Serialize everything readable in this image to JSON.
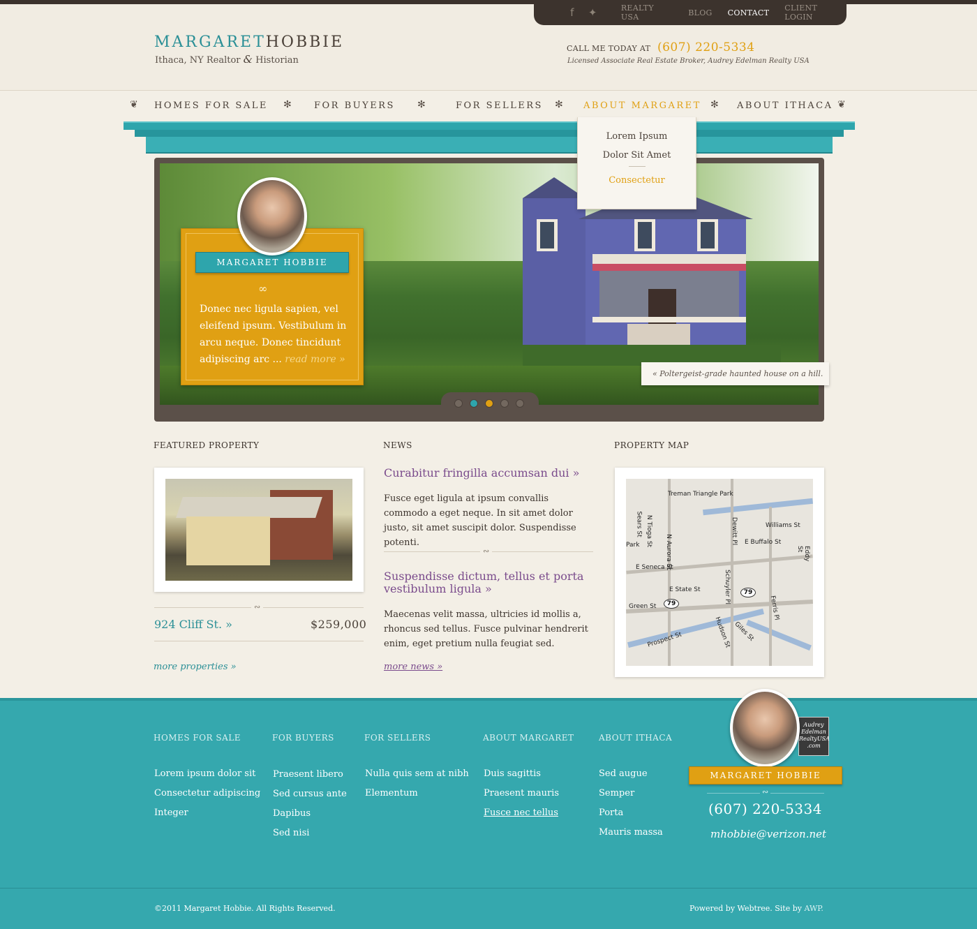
{
  "utility_nav": {
    "icons": [
      "facebook-icon",
      "twitter-icon"
    ],
    "links": [
      "REALTY USA",
      "BLOG",
      "CONTACT",
      "CLIENT LOGIN"
    ]
  },
  "logo": {
    "first": "MARGARET",
    "last": "HOBBIE",
    "tagline_a": "Ithaca, NY Realtor ",
    "tagline_amp": "&",
    "tagline_b": " Historian"
  },
  "contact": {
    "call_label": "CALL ME TODAY AT",
    "phone": "(607) 220-5334",
    "licensed": "Licensed Associate Real Estate Broker, Audrey Edelman Realty USA"
  },
  "main_nav": [
    "HOMES FOR SALE",
    "FOR BUYERS",
    "FOR SELLERS",
    "ABOUT MARGARET",
    "ABOUT ITHACA"
  ],
  "dropdown": [
    "Lorem Ipsum",
    "Dolor Sit Amet",
    "Consectetur"
  ],
  "hero": {
    "name": "MARGARET HOBBIE",
    "text": "Donec nec ligula sapien, vel eleifend ipsum. Vestibulum in arcu neque. Donec tincidunt adipiscing arc ...",
    "more": "read more »",
    "caption": "« Poltergeist-grade haunted house on a hill.",
    "slides": 5,
    "active_slide": 3
  },
  "featured": {
    "title": "FEATURED PROPERTY",
    "address": "924 Cliff St. »",
    "price": "$259,000",
    "more": "more properties »"
  },
  "news": {
    "title": "NEWS",
    "items": [
      {
        "headline": "Curabitur fringilla accumsan dui »",
        "body": "Fusce eget ligula at ipsum convallis commodo a eget neque. In sit amet dolor justo, sit amet suscipit dolor. Suspendisse potenti."
      },
      {
        "headline": "Suspendisse dictum, tellus et porta vestibulum ligula »",
        "body": "Maecenas velit massa, ultricies id mollis a, rhoncus sed tellus. Fusce pulvinar hendrerit enim, eget pretium nulla feugiat sed."
      }
    ],
    "more": "more news »"
  },
  "map": {
    "title": "PROPERTY MAP",
    "labels": [
      "Treman Triangle Park",
      "Sears St",
      "N Tioga St",
      "N Aurora St",
      "Williams St",
      "Dewitt Pl",
      "E Buffalo St",
      "Park",
      "E Seneca St",
      "Schuyler Pl",
      "E State St",
      "Green St",
      "Prospect St",
      "Hudson St",
      "Giles St",
      "Ferris Pl",
      "Eddy St",
      "79"
    ]
  },
  "footer": {
    "columns": [
      {
        "title": "HOMES FOR SALE",
        "links": [
          "Lorem ipsum dolor sit",
          "Consectetur adipiscing",
          "Integer"
        ]
      },
      {
        "title": "FOR BUYERS",
        "links": [
          "Praesent libero",
          "Sed cursus ante",
          "Dapibus",
          "Sed nisi"
        ]
      },
      {
        "title": "FOR SELLERS",
        "links": [
          "Nulla quis sem at nibh",
          "Elementum"
        ]
      },
      {
        "title": "ABOUT MARGARET",
        "links": [
          "Duis sagittis",
          "Praesent mauris",
          "Fusce nec tellus"
        ]
      },
      {
        "title": "ABOUT ITHACA",
        "links": [
          "Sed augue",
          "Semper",
          "Porta",
          "Mauris massa"
        ]
      }
    ],
    "badge": "Audrey Edelman RealtyUSA .com",
    "name": "MARGARET HOBBIE",
    "phone": "(607) 220-5334",
    "email": "mhobbie@verizon.net",
    "copyright": "©2011 Margaret Hobbie.  All Rights Reserved.",
    "powered": "Powered by Webtree.   Site by ",
    "awp": "AWP."
  },
  "colors": {
    "accent_teal": "#2ea5ac",
    "accent_gold": "#e0a013",
    "news_purple": "#7a4b8c",
    "dark_brown": "#3c332d"
  }
}
